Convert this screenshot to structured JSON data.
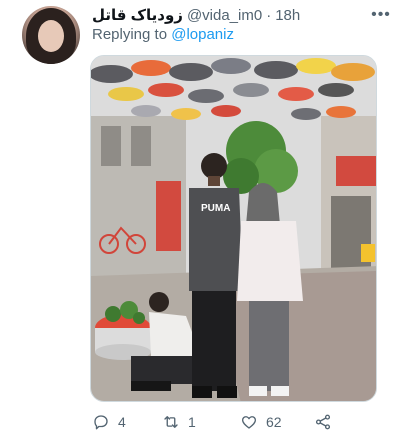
{
  "tweet": {
    "display_name": "زودیاک قاتل",
    "handle": "@vida_im0",
    "separator": "·",
    "time": "18h",
    "replying_prefix": "Replying to",
    "replying_to": "@lopaniz",
    "more_icon": "more-dots-icon",
    "photo_sign_text": "PUMA"
  },
  "actions": {
    "reply_count": "4",
    "retweet_count": "1",
    "like_count": "62",
    "share_count": ""
  },
  "colors": {
    "link": "#1d9bf0",
    "muted": "#536471",
    "text": "#0f1419"
  }
}
